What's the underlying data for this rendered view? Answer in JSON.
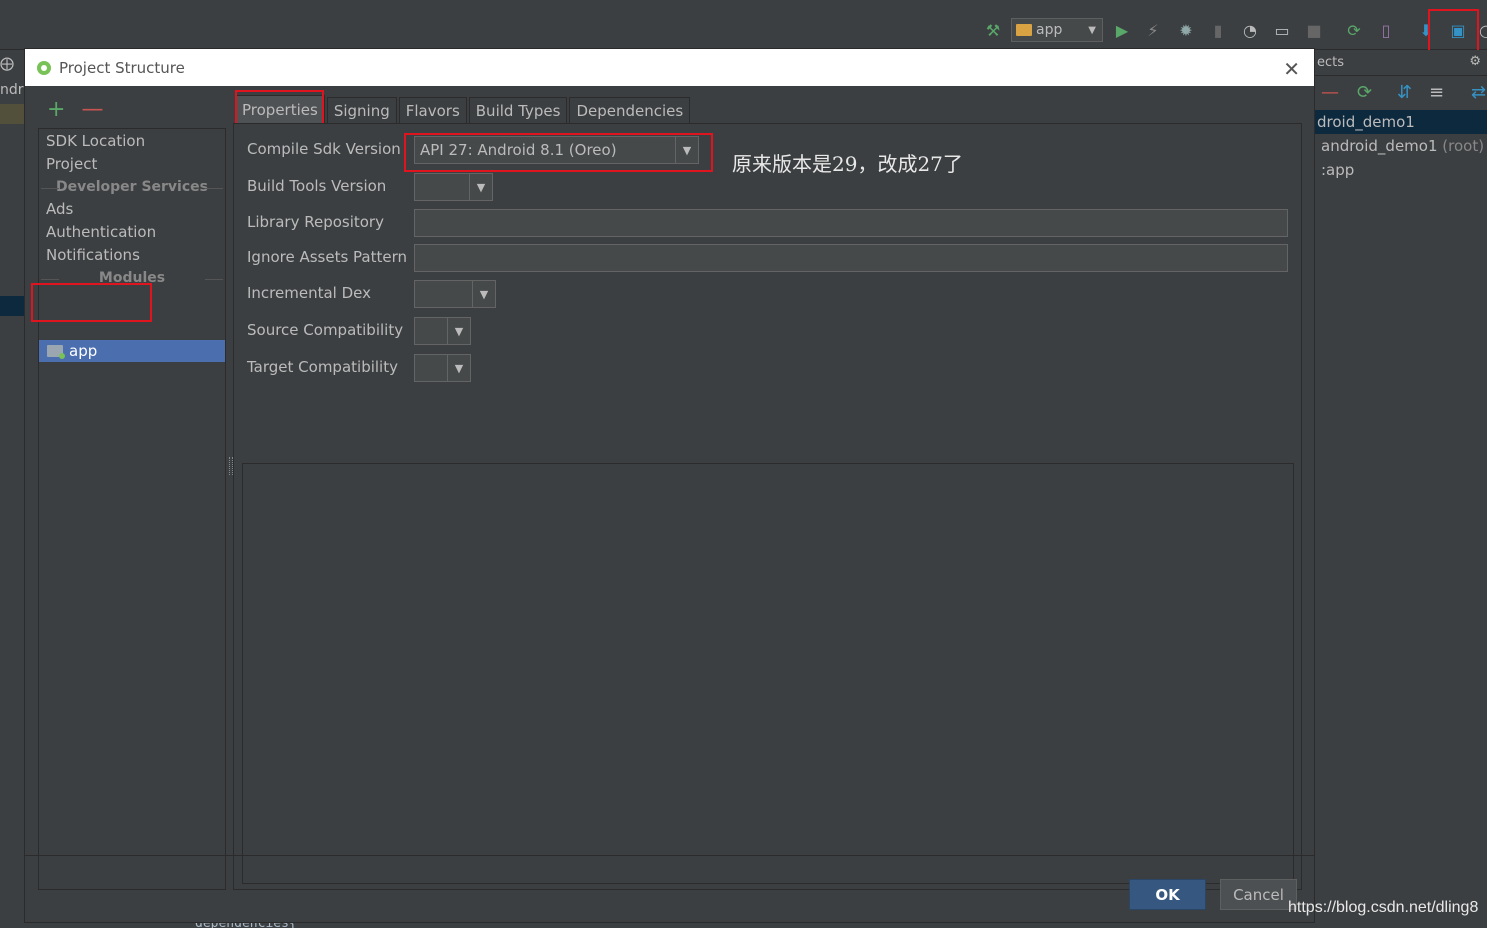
{
  "ide": {
    "run_config": "app",
    "right_panel": {
      "header": "ects",
      "tree": [
        {
          "label": "droid_demo1",
          "suffix": ""
        },
        {
          "label": "android_demo1",
          "suffix": "(root)"
        },
        {
          "label": ":app",
          "suffix": ""
        }
      ]
    },
    "left_strip_text": "ndr",
    "background_code": "dependencies{"
  },
  "dialog": {
    "title": "Project Structure",
    "sidebar": {
      "items_top": [
        "SDK Location",
        "Project"
      ],
      "group_developer": "Developer Services",
      "items_dev": [
        "Ads",
        "Authentication",
        "Notifications"
      ],
      "group_modules": "Modules",
      "selected_module": "app"
    },
    "tabs": [
      "Properties",
      "Signing",
      "Flavors",
      "Build Types",
      "Dependencies"
    ],
    "active_tab": "Properties",
    "form": {
      "compile_sdk_label": "Compile Sdk Version",
      "compile_sdk_value": "API 27: Android 8.1 (Oreo)",
      "build_tools_label": "Build Tools Version",
      "build_tools_value": "",
      "library_repo_label": "Library Repository",
      "library_repo_value": "",
      "ignore_assets_label": "Ignore Assets Pattern",
      "ignore_assets_value": "",
      "incremental_dex_label": "Incremental Dex",
      "incremental_dex_value": "",
      "source_compat_label": "Source Compatibility",
      "source_compat_value": "",
      "target_compat_label": "Target Compatibility",
      "target_compat_value": ""
    },
    "annotation": "原来版本是29，改成27了",
    "buttons": {
      "ok": "OK",
      "cancel": "Cancel"
    }
  },
  "watermark": "https://blog.csdn.net/dling8",
  "colors": {
    "background": "#3c3f41",
    "selection": "#4b6eaf",
    "highlight_box": "#e0141e",
    "ok_button": "#365880"
  }
}
